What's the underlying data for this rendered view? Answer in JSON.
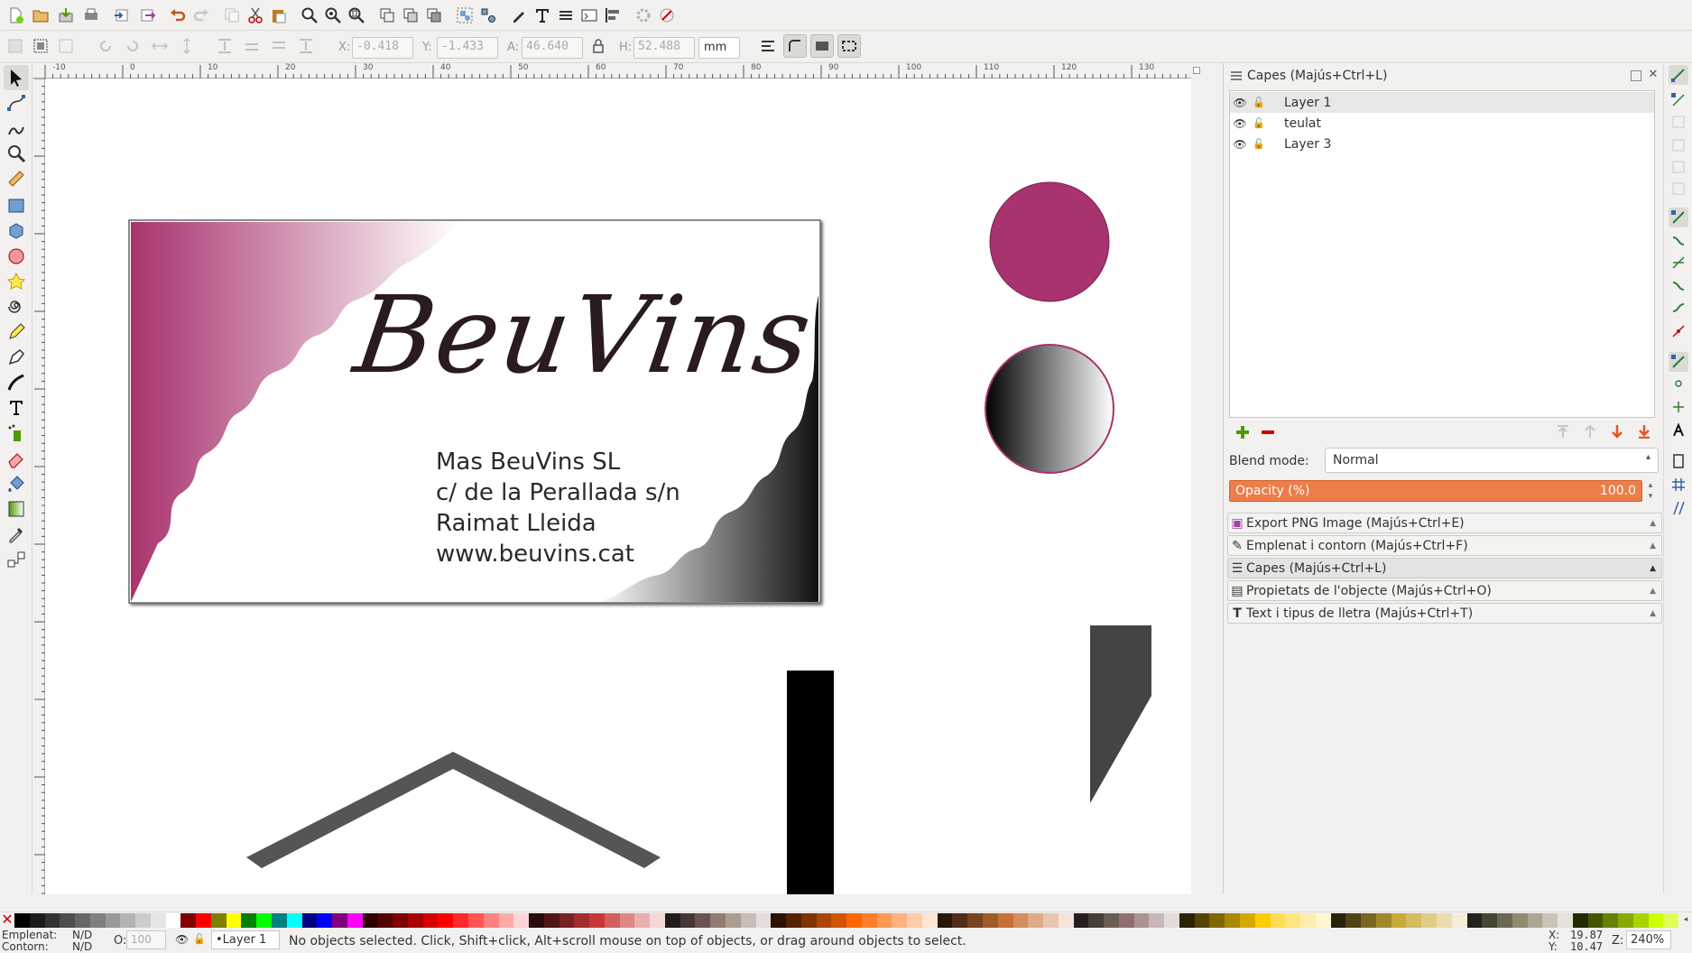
{
  "toolbar1": {
    "icons": [
      "new-doc-icon",
      "open-icon",
      "save-icon",
      "print-icon",
      "import-icon",
      "export-icon",
      "undo-icon",
      "redo-icon",
      "copy-icon",
      "cut-icon",
      "paste-icon",
      "zoom-selection-icon",
      "zoom-drawing-icon",
      "zoom-page-icon",
      "duplicate-icon",
      "clone-icon",
      "unlink-clone-icon",
      "group-icon",
      "ungroup-icon",
      "xml-editor-icon",
      "text-icon",
      "layers-icon",
      "export-png-icon",
      "align-icon",
      "preferences-icon",
      "doc-properties-icon"
    ]
  },
  "toolbar2": {
    "x_label": "X:",
    "x_value": "-0.418",
    "y_label": "Y:",
    "y_value": "-1.433",
    "w_label": "A:",
    "w_value": "46.640",
    "h_label": "H:",
    "h_value": "52.488",
    "unit": "mm"
  },
  "ruler": {
    "ticks": [
      "-10",
      "0",
      "10",
      "20",
      "30",
      "40",
      "50",
      "60",
      "70",
      "80",
      "90",
      "100",
      "110",
      "120",
      "130"
    ]
  },
  "card": {
    "brand": "BeuVins",
    "line1": "Mas BeuVins SL",
    "line2": "c/ de la Perallada s/n",
    "line3": "Raimat Lleida",
    "line4": "www.beuvins.cat"
  },
  "panel": {
    "title": "Capes (Majús+Ctrl+L)",
    "layers": [
      {
        "name": "Layer 1",
        "selected": true
      },
      {
        "name": "teulat",
        "selected": false
      },
      {
        "name": "Layer 3",
        "selected": false
      }
    ],
    "blend_label": "Blend mode:",
    "blend_value": "Normal",
    "opacity_label": "Opacity (%)",
    "opacity_value": "100.0",
    "docks": [
      "Export PNG Image (Majús+Ctrl+E)",
      "Emplenat i contorn (Majús+Ctrl+F)",
      "Capes (Majús+Ctrl+L)",
      "Propietats de l'objecte (Majús+Ctrl+O)",
      "Text i tipus de lletra (Majús+Ctrl+T)"
    ]
  },
  "status": {
    "fill_label": "Emplenat:",
    "fill_value": "N/D",
    "stroke_label": "Contorn:",
    "stroke_value": "N/D",
    "opacity_label": "O:",
    "opacity_value": "100",
    "layer": "•Layer 1",
    "message": "No objects selected. Click, Shift+click, Alt+scroll mouse on top of objects, or drag around objects to select.",
    "x_label": "X:",
    "x_value": "19.87",
    "y_label": "Y:",
    "y_value": "10.47",
    "zoom_label": "Z:",
    "zoom_value": "240%"
  },
  "colors": {
    "accent": "#e95420",
    "magenta": "#a8336e",
    "palette": [
      "#000000",
      "#1a1a1a",
      "#333333",
      "#4d4d4d",
      "#666666",
      "#808080",
      "#999999",
      "#b3b3b3",
      "#cccccc",
      "#e6e6e6",
      "#ffffff",
      "#800000",
      "#ff0000",
      "#808000",
      "#ffff00",
      "#008000",
      "#00ff00",
      "#008080",
      "#00ffff",
      "#000080",
      "#0000ff",
      "#800080",
      "#ff00ff",
      "#2b0000",
      "#550000",
      "#800000",
      "#aa0000",
      "#d40000",
      "#ff0000",
      "#ff2a2a",
      "#ff5555",
      "#ff8080",
      "#ffaaaa",
      "#ffd5d5",
      "#280b0b",
      "#501616",
      "#782121",
      "#a02c2c",
      "#c83737",
      "#d35f5f",
      "#de8787",
      "#e9afaf",
      "#f4d7d7",
      "#241c1c",
      "#483737",
      "#6c5353",
      "#917c6f",
      "#ac9d93",
      "#c8beb7",
      "#e3dedb",
      "#2b1100",
      "#552200",
      "#803300",
      "#aa4400",
      "#d45500",
      "#ff6600",
      "#ff7f2a",
      "#ff9955",
      "#ffb380",
      "#ffccaa",
      "#ffe6d5",
      "#28170b",
      "#502d16",
      "#784421",
      "#a05a2c",
      "#c87137",
      "#d38d5f",
      "#deaa87",
      "#e9c6af",
      "#f4e3d7",
      "#241f1c",
      "#483e37",
      "#6c5d53",
      "#916f6f",
      "#ac9393",
      "#c8b7b7",
      "#e3dbdb",
      "#2b2200",
      "#554400",
      "#806600",
      "#aa8800",
      "#d4aa00",
      "#ffcc00",
      "#ffdd55",
      "#ffe680",
      "#ffeeaa",
      "#fff6d5",
      "#28220b",
      "#504416",
      "#786721",
      "#a0892c",
      "#c8ab37",
      "#d3bc5f",
      "#decd87",
      "#e9ddaf",
      "#f4eed7",
      "#24221c",
      "#484537",
      "#6c6753",
      "#918a6f",
      "#aca793",
      "#c8c4b7",
      "#e3e2db",
      "#222b00",
      "#445500",
      "#668000",
      "#88aa00",
      "#aad400",
      "#ccff00",
      "#ddff55"
    ]
  }
}
